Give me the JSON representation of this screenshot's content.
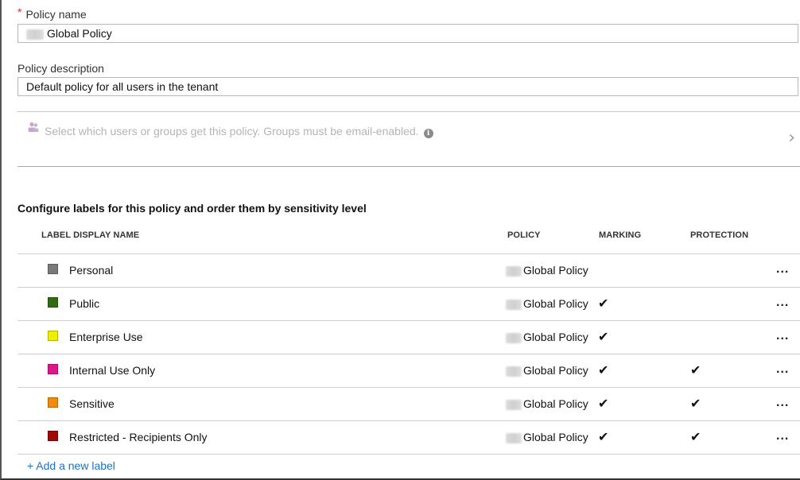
{
  "policy_name": {
    "label": "Policy name",
    "required_marker": "*",
    "value": "Global Policy"
  },
  "policy_description": {
    "label": "Policy description",
    "value": "Default policy for all users in the tenant"
  },
  "assignment": {
    "text": "Select which users or groups get this policy. Groups must be email-enabled.",
    "info_glyph": "i",
    "chevron_glyph": "›"
  },
  "labels_section": {
    "title": "Configure labels for this policy and order them by sensitivity level",
    "columns": {
      "name": "LABEL DISPLAY NAME",
      "policy": "POLICY",
      "marking": "MARKING",
      "protection": "PROTECTION"
    },
    "rows": [
      {
        "name": "Personal",
        "color": "#7a7a7a",
        "policy": "Global Policy",
        "marking": "",
        "protection": "",
        "more": "..."
      },
      {
        "name": "Public",
        "color": "#2e6b12",
        "policy": "Global Policy",
        "marking": "✔",
        "protection": "",
        "more": "..."
      },
      {
        "name": "Enterprise Use",
        "color": "#f2ee00",
        "policy": "Global Policy",
        "marking": "✔",
        "protection": "",
        "more": "..."
      },
      {
        "name": "Internal Use Only",
        "color": "#e0158c",
        "policy": "Global Policy",
        "marking": "✔",
        "protection": "✔",
        "more": "..."
      },
      {
        "name": "Sensitive",
        "color": "#f28a10",
        "policy": "Global Policy",
        "marking": "✔",
        "protection": "✔",
        "more": "..."
      },
      {
        "name": "Restricted - Recipients Only",
        "color": "#9e0a0a",
        "policy": "Global Policy",
        "marking": "✔",
        "protection": "✔",
        "more": "..."
      }
    ],
    "add_label": "+ Add a new label"
  },
  "icons": {
    "users": "users-group-icon",
    "info": "info-icon",
    "chevron": "chevron-right-icon",
    "more": "more-options-icon"
  }
}
